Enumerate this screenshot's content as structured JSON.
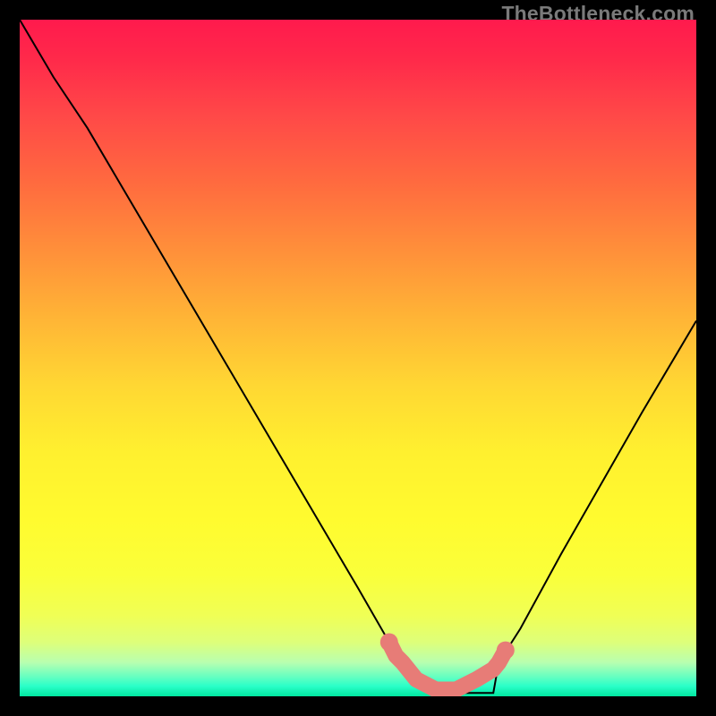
{
  "watermark": "TheBottleneck.com",
  "chart_data": {
    "type": "line",
    "title": "",
    "xlabel": "",
    "ylabel": "",
    "xlim": [
      0,
      100
    ],
    "ylim": [
      0,
      100
    ],
    "grid": false,
    "legend": false,
    "series": [
      {
        "name": "black-curve",
        "color": "#000000",
        "x": [
          0.0,
          5.0,
          10.0,
          15.0,
          20.0,
          25.0,
          30.0,
          35.0,
          40.0,
          45.0,
          50.0,
          54.6,
          56.6,
          63.0,
          70.0,
          70.8,
          74.0,
          80.0,
          86.0,
          92.0,
          100.0
        ],
        "y": [
          100.0,
          91.5,
          84.0,
          75.5,
          67.0,
          58.5,
          50.0,
          41.5,
          33.0,
          24.5,
          16.0,
          8.0,
          5.0,
          0.5,
          0.5,
          5.0,
          10.0,
          21.0,
          31.5,
          42.0,
          55.5
        ]
      },
      {
        "name": "salmon-band",
        "color": "#e77c77",
        "x": [
          54.6,
          55.6,
          56.6,
          58.6,
          61.5,
          64.5,
          67.5,
          70.0,
          70.8,
          71.8
        ],
        "y": [
          8.0,
          6.0,
          5.0,
          2.5,
          1.0,
          1.0,
          2.5,
          4.0,
          5.0,
          6.8
        ]
      }
    ],
    "notes": "Axes are not labeled. Values are estimated proportionally on [0,100] for both x and y. y=0 is the bottom (green) and y=100 is the top (red)."
  },
  "colors": {
    "background": "#000000",
    "curve": "#000000",
    "band": "#e77c77",
    "watermark": "#7a7a7a"
  }
}
